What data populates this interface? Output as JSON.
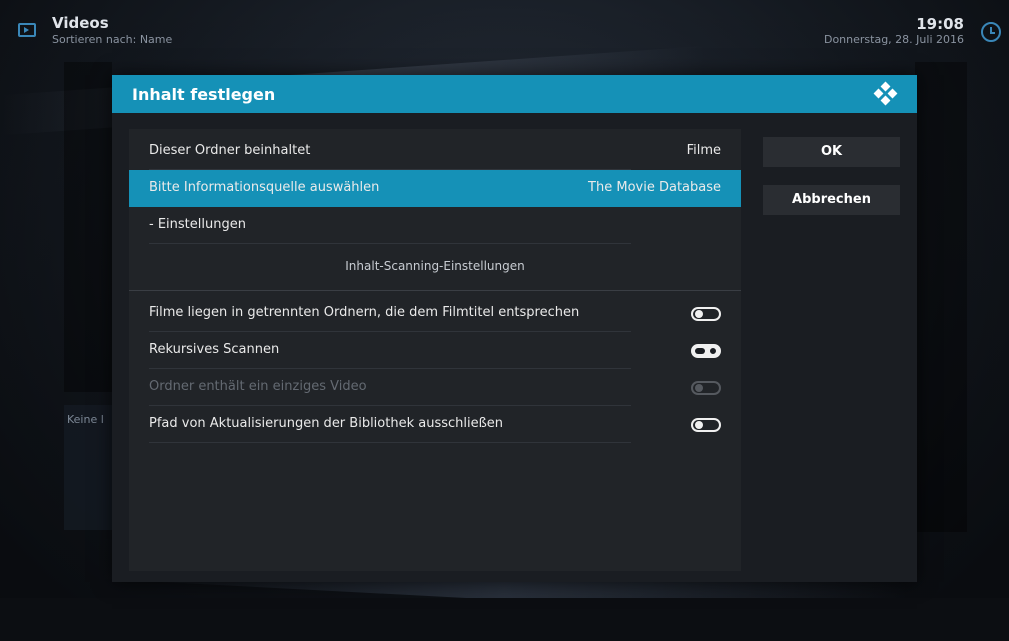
{
  "topbar": {
    "title": "Videos",
    "subtitle": "Sortieren nach: Name",
    "time": "19:08",
    "date": "Donnerstag, 28. Juli 2016"
  },
  "background": {
    "keine_text": "Keine l"
  },
  "dialog": {
    "title": "Inhalt festlegen",
    "rows": [
      {
        "label": "Dieser Ordner beinhaltet",
        "value": "Filme"
      },
      {
        "label": "Bitte Informationsquelle auswählen",
        "value": "The Movie Database"
      },
      {
        "label": "- Einstellungen",
        "value": ""
      }
    ],
    "section_label": "Inhalt-Scanning-Einstellungen",
    "toggles": [
      {
        "label": "Filme liegen in getrennten Ordnern, die dem Filmtitel entsprechen",
        "state": "off",
        "enabled": true
      },
      {
        "label": "Rekursives Scannen",
        "state": "on",
        "enabled": true
      },
      {
        "label": "Ordner enthält ein einziges Video",
        "state": "off",
        "enabled": false
      },
      {
        "label": "Pfad von Aktualisierungen der Bibliothek ausschließen",
        "state": "off",
        "enabled": true
      }
    ],
    "ok_label": "OK",
    "cancel_label": "Abbrechen"
  },
  "icons": {
    "app_icon": "tv-icon",
    "clock_icon": "clock-icon",
    "logo_icon": "kodi-logo-icon"
  },
  "colors": {
    "accent": "#1591b7",
    "dialog_bg": "#1a1d22",
    "list_bg": "#212428"
  }
}
